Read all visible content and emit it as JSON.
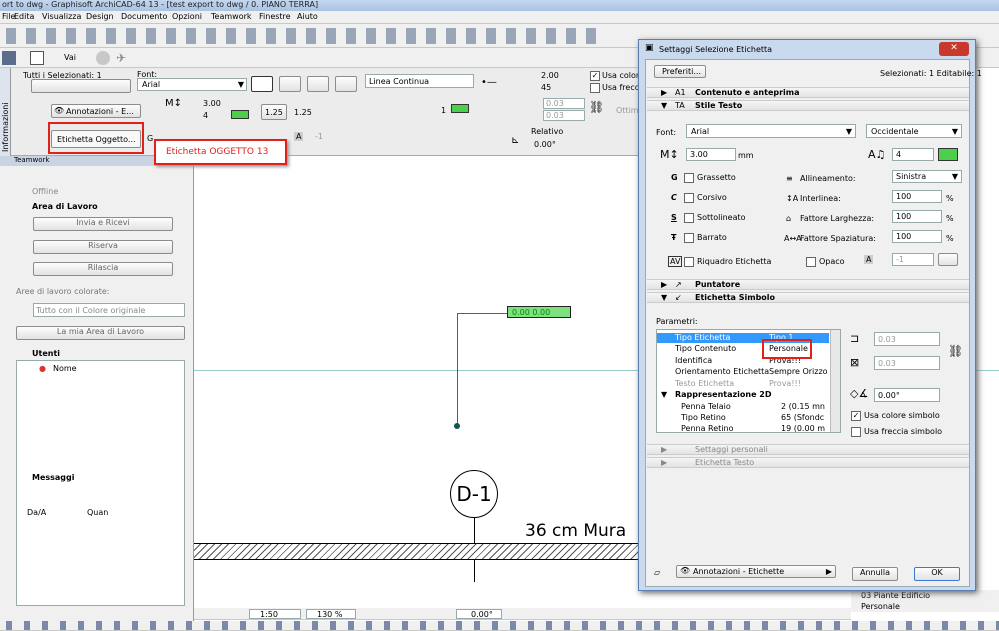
{
  "app": {
    "title": "ort to dwg - Graphisoft ArchiCAD-64 13 - [test export to dwg / 0. PIANO TERRA]"
  },
  "menu": [
    "File",
    "Edita",
    "Visualizza",
    "Design",
    "Documento",
    "Opzioni",
    "Teamwork",
    "Finestre",
    "Aiuto"
  ],
  "toolbar": {
    "vai": "Vai"
  },
  "info_box": {
    "tutti": "Tutti i Selezionati: 1",
    "font_label": "Font:",
    "font_value": "Arial",
    "line_type": "Linea Continua",
    "height": "3.00",
    "pen": "4",
    "pen2": "2.00",
    "pen3": "45",
    "usa_colore": "Usa colore",
    "usa_freccia": "Usa freccia",
    "scale1": "1.25",
    "scale2": "1.25",
    "layer": "Annotazioni - E...",
    "label_type": "Etichetta Oggetto...",
    "relativo": "Relativo",
    "angle": "0.00°",
    "val03a": "0.03",
    "val03b": "0.03",
    "pen_sm": "1",
    "layer_a": "A",
    "ottim": "Ottim",
    "neg1": "-1",
    "g": "G"
  },
  "callout": {
    "text": "Etichetta OGGETTO 13"
  },
  "sidebar": {
    "tab": "Informazioni",
    "teamwork": "Teamwork",
    "offline": "Offline",
    "area": "Area di Lavoro",
    "invia": "Invia e Ricevi",
    "riserva": "Riserva",
    "rilascia": "Rilascia",
    "aree_label": "Aree di lavoro colorate:",
    "tutto": "Tutto con il Colore originale",
    "mia_area": "La mia Area di Lavoro",
    "utenti": "Utenti",
    "nome": "Nome",
    "messaggi": "Messaggi",
    "da": "Da/A",
    "quan": "Quan"
  },
  "canvas": {
    "label_text": "0.00 0.00",
    "marker": "D-1",
    "wall_text": "36 cm  Mura"
  },
  "statusbar": {
    "scale": "1:50",
    "zoom": "130 %",
    "angle": "0.00°"
  },
  "right_panel": {
    "tabs": [
      "03 Piante Edificio",
      "Personale"
    ]
  },
  "dialog": {
    "title": "Settaggi Selezione Etichetta",
    "preferiti": "Preferiti...",
    "selezionati": "Selezionati: 1 Editabile: 1",
    "sec_contenuto": "Contenuto e anteprima",
    "sec_stile": "Stile Testo",
    "font_label": "Font:",
    "font_value": "Arial",
    "script_value": "Occidentale",
    "size": "3.00",
    "unit": "mm",
    "pen": "4",
    "grassetto": "Grassetto",
    "corsivo": "Corsivo",
    "sottolineato": "Sottolineato",
    "barrato": "Barrato",
    "allineamento": "Allineamento:",
    "allineamento_val": "Sinistra",
    "interlinea": "Interlinea:",
    "interlinea_val": "100",
    "larghezza": "Fattore Larghezza:",
    "larghezza_val": "100",
    "spaziatura": "Fattore Spaziatura:",
    "spaziatura_val": "100",
    "pct": "%",
    "riquadro": "Riquadro Etichetta",
    "opaco": "Opaco",
    "neg1": "-1",
    "sec_puntatore": "Puntatore",
    "sec_simbolo": "Etichetta Simbolo",
    "parametri": "Parametri:",
    "params": [
      {
        "name": "Tipo Etichetta",
        "value": "Tipo 1",
        "selected": true
      },
      {
        "name": "Tipo Contenuto",
        "value": "Personale"
      },
      {
        "name": "Identifica",
        "value": "Prova!!!"
      },
      {
        "name": "Orientamento Etichetta",
        "value": "Sempre Orizzo"
      },
      {
        "name": "Testo Etichetta",
        "value": "Prova!!!",
        "disabled": true
      },
      {
        "name": "Rappresentazione 2D",
        "value": "",
        "group": true
      },
      {
        "name": "Penna Telaio",
        "value": "2 (0.15 mn",
        "sub": true
      },
      {
        "name": "Tipo Retino",
        "value": "65 (Sfondc",
        "sub": true
      },
      {
        "name": "Penna Retino",
        "value": "19 (0.00 m",
        "sub": true
      }
    ],
    "dim1": "0.03",
    "dim2": "0.03",
    "rot": "0.00°",
    "usa_colore": "Usa colore simbolo",
    "usa_freccia": "Usa freccia simbolo",
    "sec_personali": "Settaggi personali",
    "sec_testo": "Etichetta Testo",
    "layer": "Annotazioni - Etichette",
    "annulla": "Annulla",
    "ok": "OK"
  },
  "colors": {
    "accent": "#3399ff",
    "red": "#e0201b",
    "green": "#4cd04c",
    "dlg_border": "#6a8db8"
  }
}
